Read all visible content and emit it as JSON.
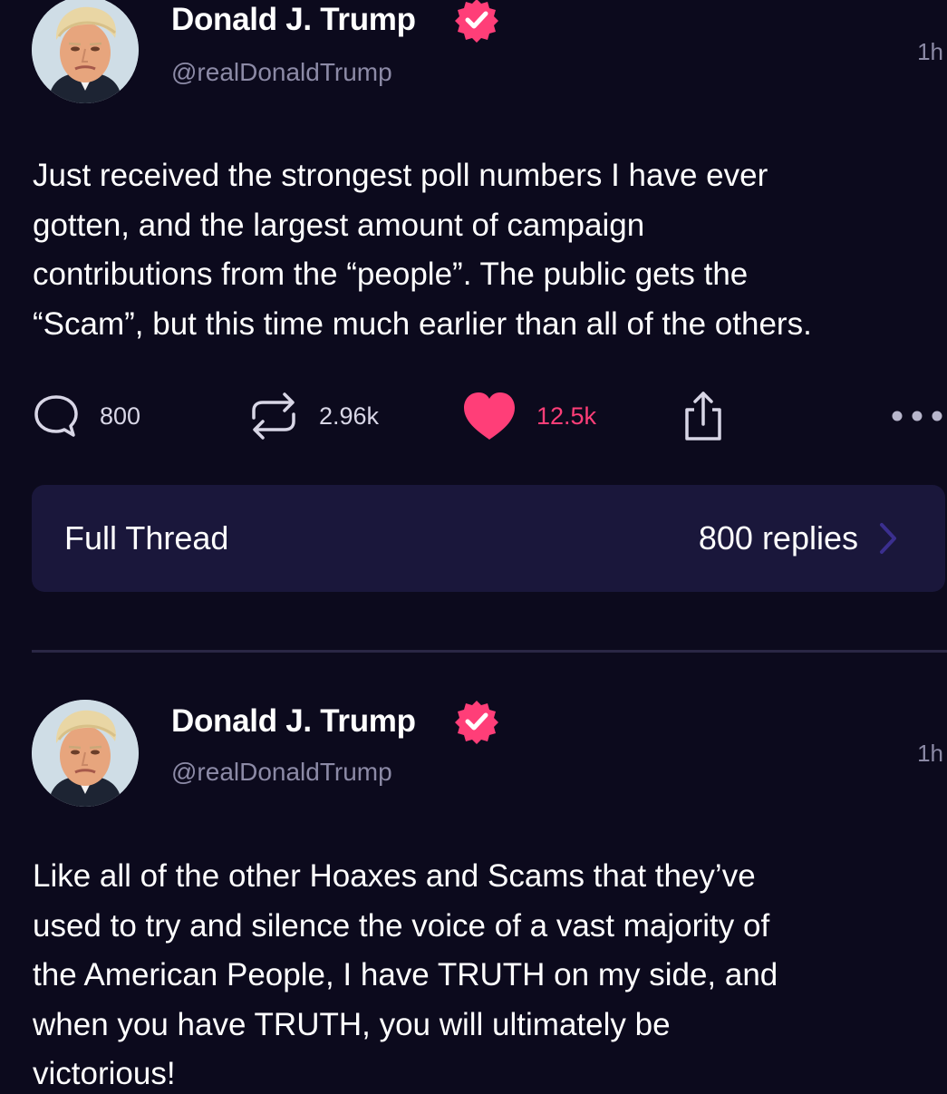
{
  "colors": {
    "background": "#0c0a1d",
    "accent_pink": "#ff3e78",
    "muted_text": "#8c8aa6",
    "card_background": "#1a173b",
    "divider": "#2a2745",
    "chevron": "#3b2f8f"
  },
  "posts": [
    {
      "author_name": "Donald J. Trump",
      "handle": "@realDonaldTrump",
      "time": "1h",
      "verified_icon": "verified-badge-icon",
      "body": "Just received the strongest poll numbers I have ever\ngotten, and the largest amount of campaign\ncontributions from the “people”. The public gets the\n“Scam”, but this time much earlier than all of the others.",
      "actions": {
        "replies": "800",
        "retruths": "2.96k",
        "likes": "12.5k"
      },
      "thread": {
        "title": "Full Thread",
        "replies_label": "800 replies"
      }
    },
    {
      "author_name": "Donald J. Trump",
      "handle": "@realDonaldTrump",
      "time": "1h",
      "verified_icon": "verified-badge-icon",
      "body": "Like all of the other Hoaxes and Scams that they’ve\nused to try and silence the voice of a vast majority of\nthe American People, I have TRUTH on my side, and\nwhen you have TRUTH, you will ultimately be\nvictorious!"
    }
  ]
}
